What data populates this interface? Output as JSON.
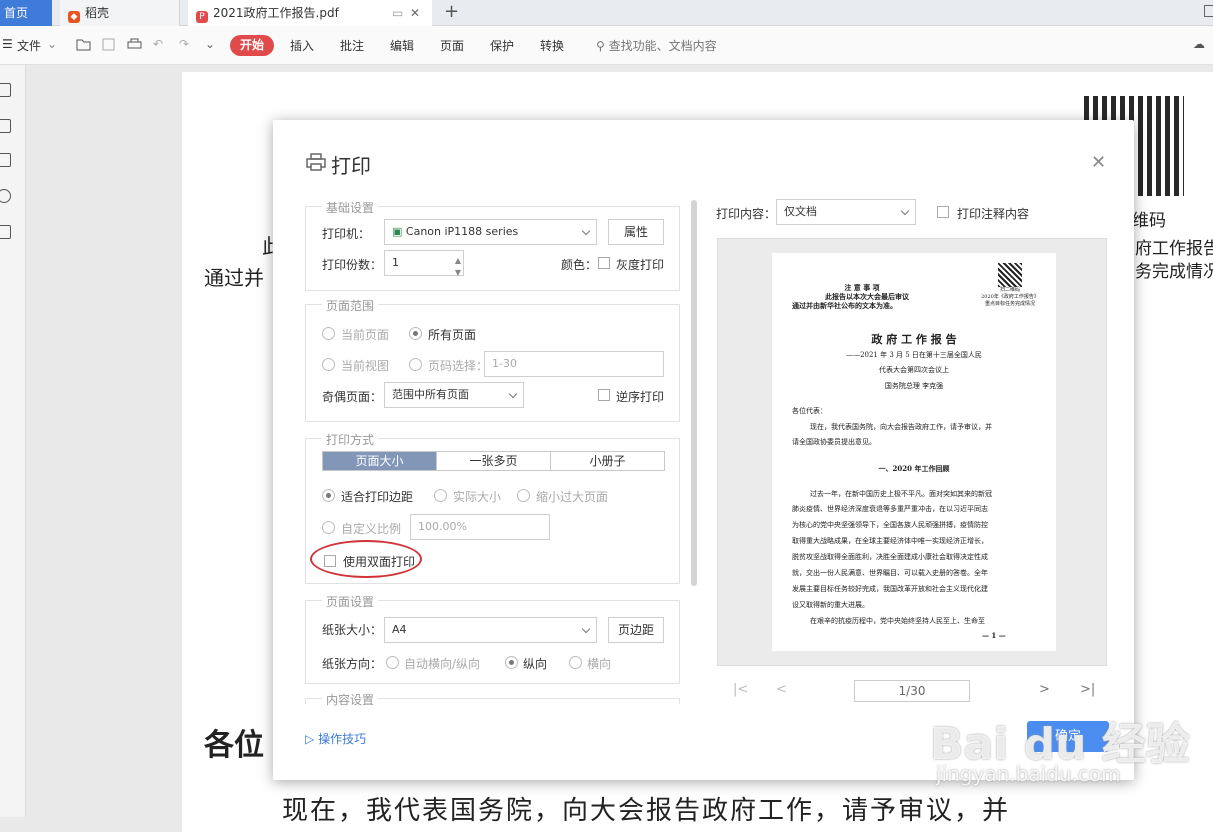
{
  "tabs": {
    "home": "首页",
    "daoke": "稻壳",
    "pdf": "2021政府工作报告.pdf"
  },
  "toolbar": {
    "file": "文件",
    "start": "开始",
    "insert": "插入",
    "annotate": "批注",
    "edit": "编辑",
    "page": "页面",
    "protect": "保护",
    "convert": "转换",
    "search": "查找功能、文档内容"
  },
  "bg": {
    "line1": "此",
    "line2": "通过并",
    "greet": "各位",
    "qr_caption": "维码",
    "right1": "府工作报告",
    "right2": "务完成情况",
    "bottom": "现在，我代表国务院，向大会报告政府工作，请予审议，并"
  },
  "dialog": {
    "title": "打印",
    "basic": {
      "label": "基础设置",
      "printer_label": "打印机：",
      "printer": "Canon iP1188 series",
      "props": "属性",
      "copies_label": "打印份数：",
      "copies": "1",
      "color_label": "颜色：",
      "gray": "灰度打印"
    },
    "range": {
      "label": "页面范围",
      "current_page": "当前页面",
      "all_pages": "所有页面",
      "current_view": "当前视图",
      "page_select": "页码选择：",
      "page_input": "1-30",
      "odd_even_label": "奇偶页面：",
      "odd_even": "范围中所有页面",
      "reverse": "逆序打印"
    },
    "mode": {
      "label": "打印方式",
      "tab1": "页面大小",
      "tab2": "一张多页",
      "tab3": "小册子",
      "fit": "适合打印边距",
      "actual": "实际大小",
      "shrink": "缩小过大页面",
      "custom": "自定义比例",
      "scale": "100.00%",
      "duplex": "使用双面打印"
    },
    "pagesetup": {
      "label": "页面设置",
      "size_label": "纸张大小：",
      "size": "A4",
      "margins": "页边距",
      "orient_label": "纸张方向：",
      "auto": "自动横向/纵向",
      "portrait": "纵向",
      "landscape": "横向"
    },
    "content": {
      "label": "内容设置"
    },
    "tips": "操作技巧",
    "print_content_label": "打印内容：",
    "print_content": "仅文档",
    "print_annot": "打印注释内容",
    "pager": "1/30",
    "ok": "确定"
  },
  "preview": {
    "notice_title": "注 意 事 项",
    "notice1": "此报告以本次大会最后审议",
    "notice2": "通过并由新华社公布的文本为准。",
    "qr_note": "扫二维码",
    "qr_note2": "2020年《政府工作报告》",
    "qr_note3": "重点目标任务完成情况",
    "title": "政 府 工 作 报 告",
    "sub1": "——2021 年 3 月 5 日在第十三届全国人民",
    "sub2": "代表大会第四次会议上",
    "sub3": "国务院总理  李克强",
    "greet": "各位代表：",
    "p1a": "现在，我代表国务院，向大会报告政府工作，请予审议，并",
    "p1b": "请全国政协委员提出意见。",
    "h1": "一、2020 年工作回顾",
    "p2a": "过去一年，在新中国历史上极不平凡。面对突如其来的新冠",
    "p2b": "肺炎疫情、世界经济深度衰退等多重严重冲击，在以习近平同志",
    "p2c": "为核心的党中央坚强领导下，全国各族人民顽强拼搏，疫情防控",
    "p2d": "取得重大战略成果，在全球主要经济体中唯一实现经济正增长，",
    "p2e": "脱贫攻坚战取得全面胜利，决胜全面建成小康社会取得决定性成",
    "p2f": "就，交出一份人民满意、世界瞩目、可以载入史册的答卷。全年",
    "p2g": "发展主要目标任务较好完成，我国改革开放和社会主义现代化建",
    "p2h": "设又取得新的重大进展。",
    "p3a": "在艰辛的抗疫历程中，党中央始终坚持人民至上、生命至",
    "pageno": "— 1 —"
  },
  "watermark": {
    "text": "Bai du 经验",
    "url": "jingyan.baidu.com"
  }
}
